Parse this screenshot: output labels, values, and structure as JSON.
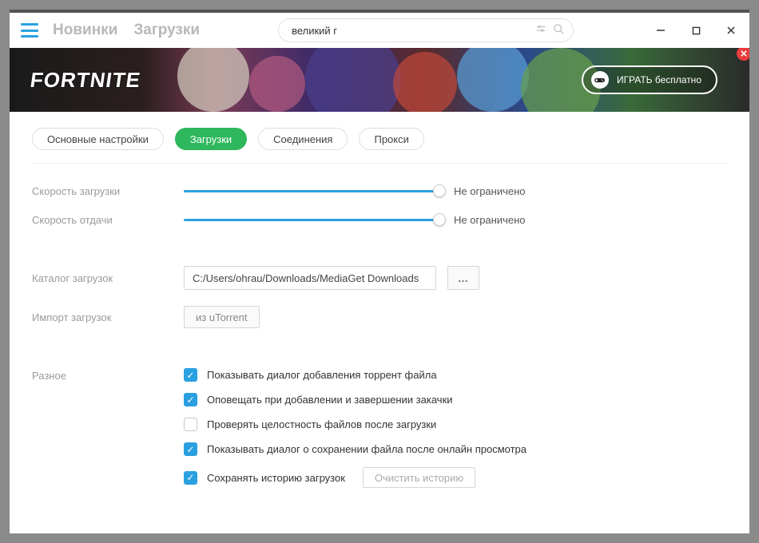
{
  "nav": {
    "link_new": "Новинки",
    "link_downloads": "Загрузки"
  },
  "search": {
    "value": "великий г",
    "placeholder": ""
  },
  "banner": {
    "logo": "FORTNITE",
    "play_label": "ИГРАТЬ бесплатно"
  },
  "tabs": [
    {
      "id": "general",
      "label": "Основные настройки",
      "active": false
    },
    {
      "id": "downloads",
      "label": "Загрузки",
      "active": true
    },
    {
      "id": "connections",
      "label": "Соединения",
      "active": false
    },
    {
      "id": "proxy",
      "label": "Прокси",
      "active": false
    }
  ],
  "settings": {
    "dl_speed": {
      "label": "Скорость загрузки",
      "value_text": "Не ограничено"
    },
    "ul_speed": {
      "label": "Скорость отдачи",
      "value_text": "Не ограничено"
    },
    "dl_folder": {
      "label": "Каталог загрузок",
      "path": "C:/Users/ohrau/Downloads/MediaGet Downloads",
      "browse": "…"
    },
    "import": {
      "label": "Импорт загрузок",
      "button": "из uTorrent"
    },
    "misc": {
      "label": "Разное",
      "opts": [
        {
          "checked": true,
          "text": "Показывать диалог добавления торрент файла"
        },
        {
          "checked": true,
          "text": "Оповещать при добавлении и завершении закачки"
        },
        {
          "checked": false,
          "text": "Проверять целостность файлов после загрузки"
        },
        {
          "checked": true,
          "text": "Показывать диалог о сохранении файла после онлайн просмотра"
        },
        {
          "checked": true,
          "text": "Сохранять историю загрузок"
        }
      ],
      "clear_history": "Очистить историю"
    }
  }
}
